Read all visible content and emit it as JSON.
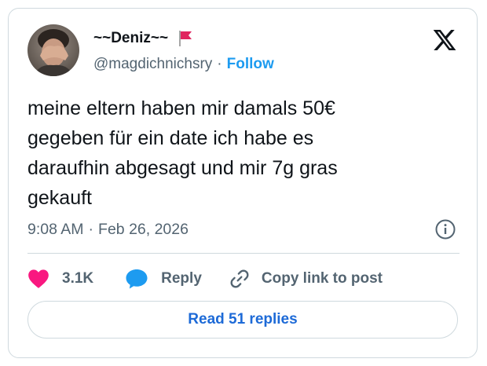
{
  "author": {
    "display_name": "~~Deniz~~",
    "handle": "@magdichnichsry",
    "separator": "·",
    "follow_label": "Follow",
    "flag_icon": "red-flag-icon"
  },
  "tweet": {
    "text_lines": [
      "meine eltern haben mir damals 50€",
      "gegeben für ein date ich habe es",
      "daraufhin abgesagt und mir 7g gras",
      "gekauft"
    ],
    "time": "9:08 AM",
    "separator": "·",
    "date": "Feb 26, 2026"
  },
  "actions": {
    "like_count": "3.1K",
    "reply_label": "Reply",
    "copy_link_label": "Copy link to post",
    "read_replies_label": "Read 51 replies"
  },
  "colors": {
    "like": "#f91880",
    "reply": "#1d9bf0",
    "link": "#1d9bf0",
    "read_replies": "#1d6ad7",
    "muted": "#536471",
    "border": "#cfd9de"
  }
}
